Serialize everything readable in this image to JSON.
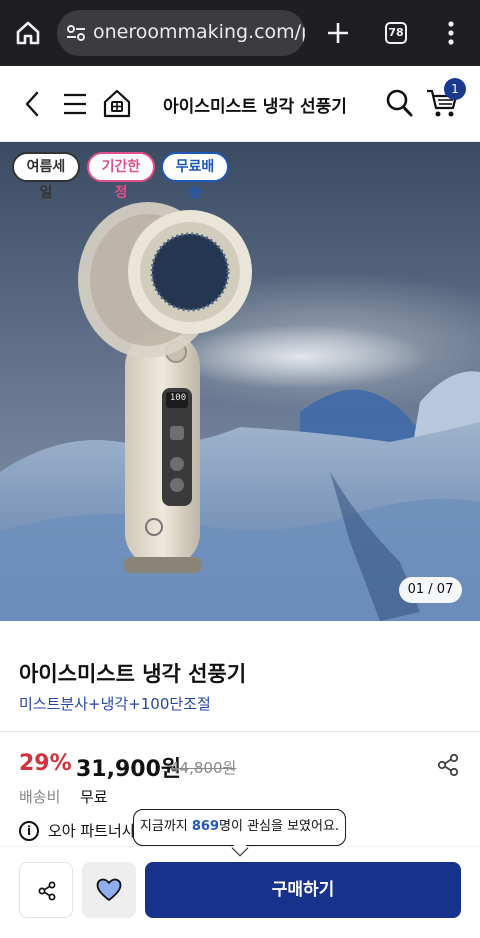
{
  "browser": {
    "url": "oneroommaking.com/pro",
    "tab_count": "78"
  },
  "header": {
    "title": "아이스미스트 냉각 선풍기",
    "cart_count": "1"
  },
  "image": {
    "tags": [
      "여름세일",
      "기간한정",
      "무료배송"
    ],
    "counter": "01 / 07",
    "display_reading": "100"
  },
  "product": {
    "name": "아이스미스트 냉각 선풍기",
    "subtitle": "미스트분사+냉각+100단조절",
    "discount": "29%",
    "price": "31,900원",
    "original_price": "44,800원",
    "shipping_label": "배송비",
    "shipping_value": "무료",
    "partner_text": "오아 파트너사"
  },
  "tooltip": {
    "prefix": "지금까지 ",
    "count": "869",
    "suffix": "명이 관심을 보였어요."
  },
  "actions": {
    "buy_label": "구매하기"
  },
  "colors": {
    "brand": "#17328a",
    "discount": "#d4323a",
    "subtitle": "#2446a8"
  }
}
